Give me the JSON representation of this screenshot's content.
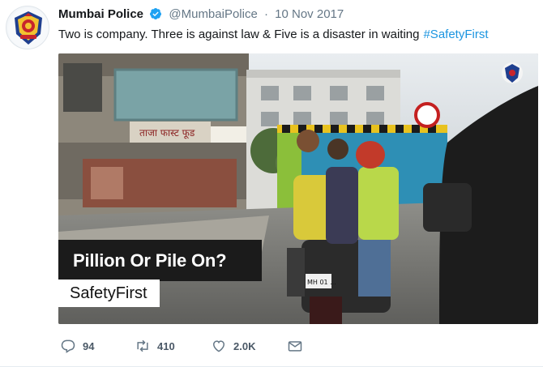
{
  "tweet": {
    "author_name": "Mumbai Police",
    "handle": "@MumbaiPolice",
    "separator": "·",
    "date": "10 Nov 2017",
    "text": "Two is company. Three is against law & Five is a disaster in waiting",
    "hashtag": "#SafetyFirst"
  },
  "media": {
    "overlay_title": "Pillion Or Pile On?",
    "overlay_tag": "SafetyFirst",
    "shop_sign": "ताजा फास्ट फूड",
    "plate": "MH 01 ..."
  },
  "actions": {
    "replies": "94",
    "retweets": "410",
    "likes": "2.0K"
  },
  "colors": {
    "link_blue": "#1b95e0",
    "verified_blue": "#1da1f2",
    "muted": "#657786"
  },
  "icons": {
    "verified": "verified-badge-icon",
    "reply": "reply-icon",
    "retweet": "retweet-icon",
    "like": "heart-icon",
    "message": "envelope-icon"
  }
}
